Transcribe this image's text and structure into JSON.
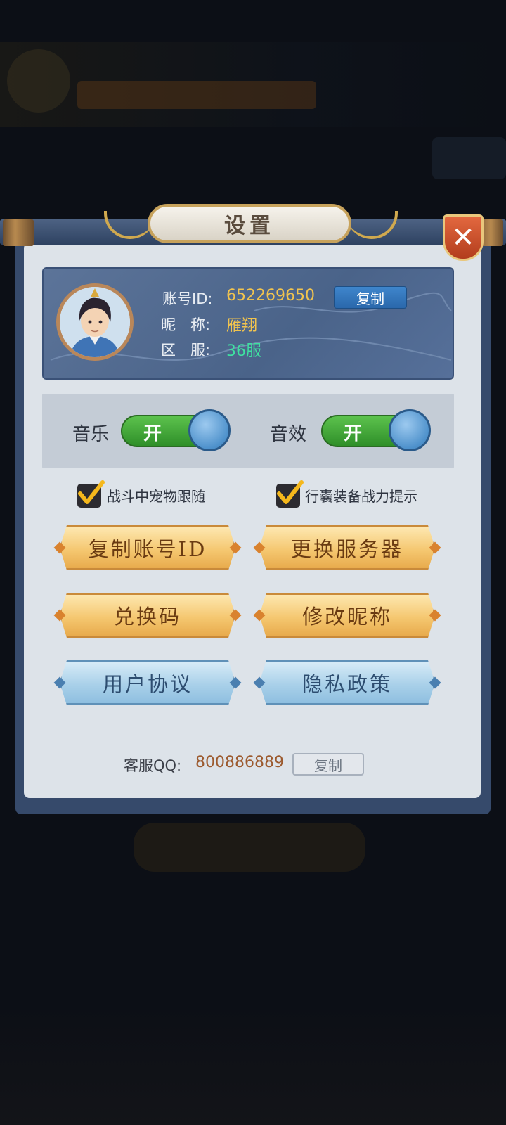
{
  "dialog": {
    "title": "设置",
    "close_icon": "close-icon"
  },
  "profile": {
    "account_label": "账号ID:",
    "account_id": "652269650",
    "copy_label": "复制",
    "nickname_label": "昵　称:",
    "nickname": "雁翔",
    "server_label": "区　服:",
    "server": "36服",
    "colors": {
      "id": "#f2c44e",
      "nickname": "#f2c44e",
      "server": "#3fe0a0"
    }
  },
  "toggles": {
    "music_label": "音乐",
    "music_state": "开",
    "sfx_label": "音效",
    "sfx_state": "开"
  },
  "checkboxes": {
    "pet_follow_label": "战斗中宠物跟随",
    "equip_power_label": "行囊装备战力提示"
  },
  "buttons": {
    "copy_account_id": "复制账号ID",
    "change_server": "更换服务器",
    "redeem_code": "兑换码",
    "edit_nickname": "修改昵称",
    "user_agreement": "用户协议",
    "privacy_policy": "隐私政策"
  },
  "customer_service": {
    "label": "客服QQ:",
    "qq": "800886889",
    "copy_label": "复制"
  }
}
